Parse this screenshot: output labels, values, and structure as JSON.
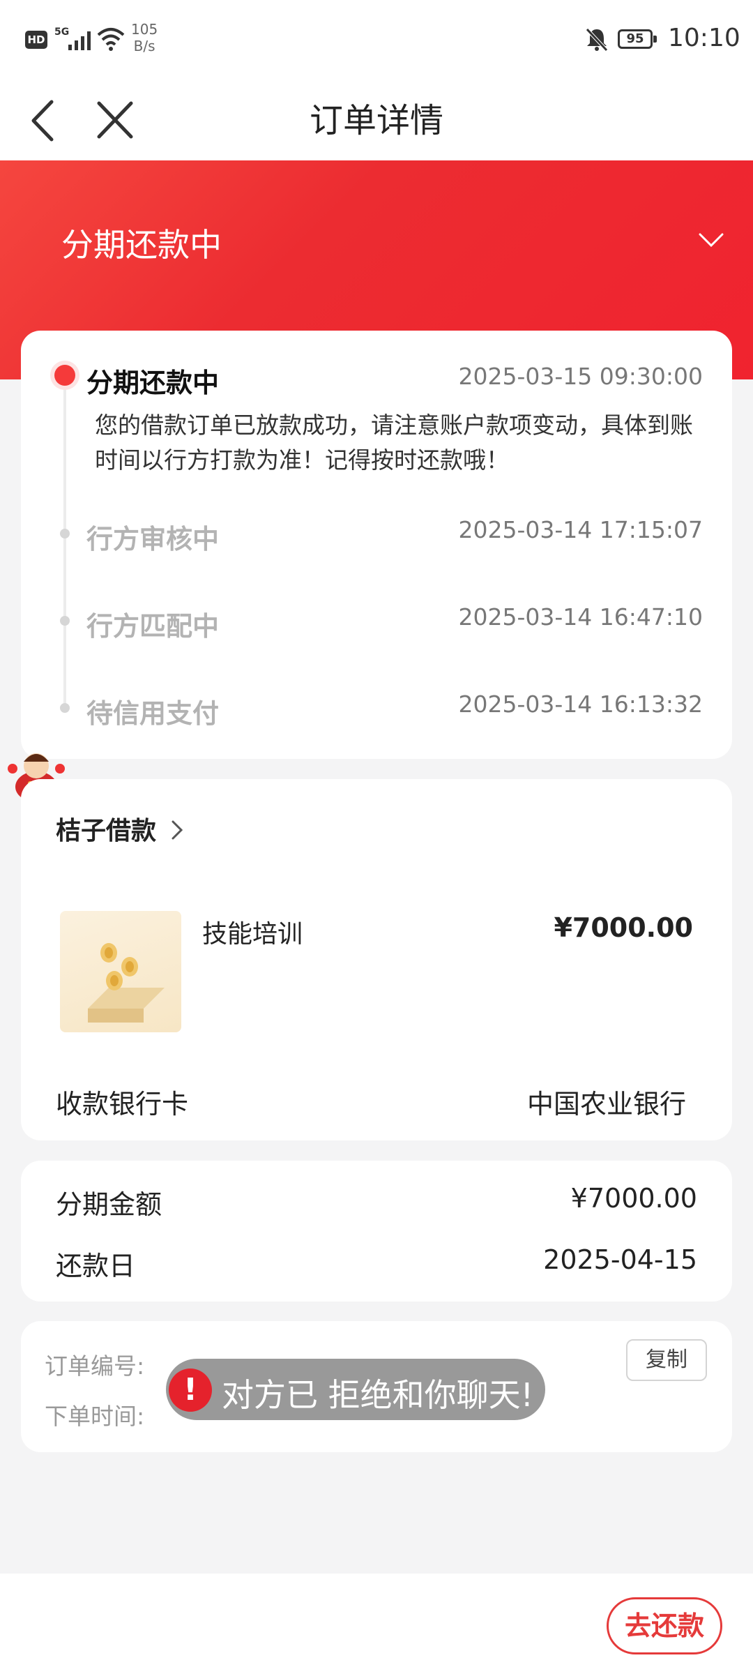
{
  "status_bar": {
    "network_label": "HD",
    "signal_label": "5G",
    "net_speed_value": "105",
    "net_speed_unit": "B/s",
    "battery": "95",
    "time": "10:10",
    "icons": [
      "signal-icon",
      "wifi-icon",
      "bell-muted-icon",
      "battery-icon"
    ]
  },
  "nav": {
    "title": "订单详情",
    "icons": [
      "back-icon",
      "close-icon"
    ]
  },
  "header": {
    "status": "分期还款中",
    "accent": "#f0232f"
  },
  "timeline": {
    "items": [
      {
        "title": "分期还款中",
        "time": "2025-03-15 09:30:00",
        "active": true,
        "desc": "您的借款订单已放款成功，请注意账户款项变动，具体到账时间以行方打款为准！记得按时还款哦！"
      },
      {
        "title": "行方审核中",
        "time": "2025-03-14 17:15:07",
        "active": false
      },
      {
        "title": "行方匹配中",
        "time": "2025-03-14 16:47:10",
        "active": false
      },
      {
        "title": "待信用支付",
        "time": "2025-03-14 16:13:32",
        "active": false
      }
    ]
  },
  "product": {
    "merchant": "桔子借款",
    "name": "技能培训",
    "price": "¥7000.00",
    "bank_label": "收款银行卡",
    "bank_value": "中国农业银行"
  },
  "amounts": {
    "installment_label": "分期金额",
    "installment_value": "¥7000.00",
    "due_label": "还款日",
    "due_value": "2025-04-15"
  },
  "order": {
    "number_label": "订单编号:",
    "time_label": "下单时间:",
    "copy_label": "复制"
  },
  "toast": {
    "icon": "!",
    "text": "对方已 拒绝和你聊天!"
  },
  "bottom": {
    "repay_label": "去还款"
  }
}
